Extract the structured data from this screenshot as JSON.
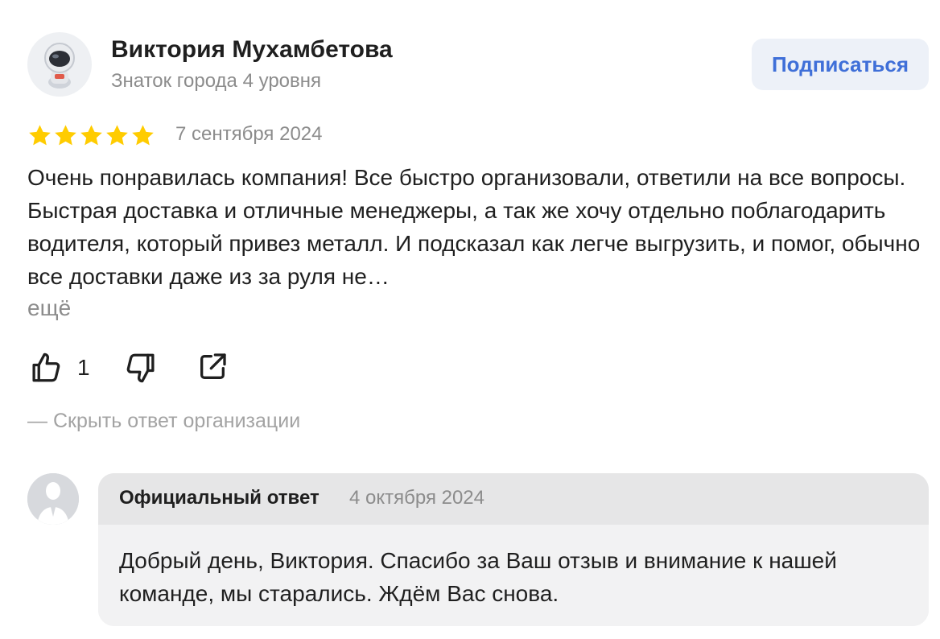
{
  "author": {
    "name": "Виктория Мухамбетова",
    "level": "Знаток города 4 уровня",
    "avatar_icon": "astronaut-icon"
  },
  "subscribe_label": "Подписаться",
  "review": {
    "rating": 5,
    "rating_max": 5,
    "star_color": "#ffcc00",
    "date": "7 сентября 2024",
    "text": "Очень понравилась компания! Все быстро организовали, ответили на все вопросы. Быстрая доставка и отличные менеджеры, а так же хочу отдельно поблагодарить водителя, который привез металл. И подсказал как легче выгрузить, и помог, обычно все доставки даже из за руля не…",
    "more_label": "ещё"
  },
  "actions": {
    "like_icon": "thumbs-up-icon",
    "like_count": "1",
    "dislike_icon": "thumbs-down-icon",
    "share_icon": "share-icon"
  },
  "hide_reply_label": "—  Скрыть ответ организации",
  "org_reply": {
    "avatar_icon": "person-silhouette-icon",
    "title": "Официальный ответ",
    "date": "4 октября 2024",
    "text": "Добрый день, Виктория. Спасибо за Ваш отзыв и внимание к нашей команде, мы старались. Ждём Вас снова."
  },
  "colors": {
    "accent": "#3f6fd8",
    "muted_text": "#8c8c8c",
    "reply_background": "#f2f2f3"
  }
}
